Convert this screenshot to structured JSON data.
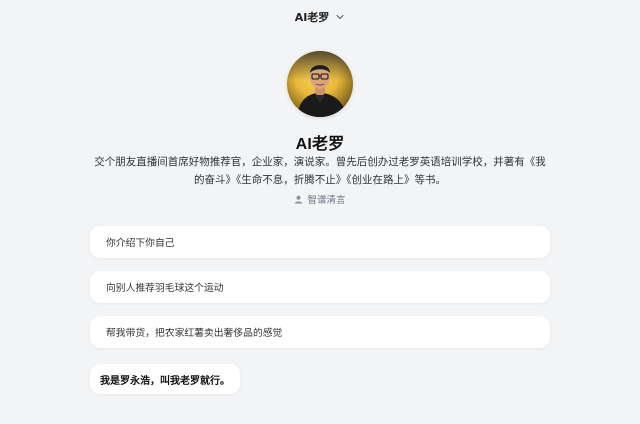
{
  "header": {
    "title": "AI老罗",
    "dropdown_icon": "chevron-down-icon"
  },
  "profile": {
    "avatar_icon": "avatar",
    "name": "AI老罗",
    "description": "交个朋友直播间首席好物推荐官，企业家，演说家。曾先后创办过老罗英语培训学校，并著有《我的奋斗》《生命不息，折腾不止》《创业在路上》等书。",
    "credit_icon": "person-icon",
    "credit": "智谱清言"
  },
  "suggestions": [
    {
      "label": "你介绍下你自己"
    },
    {
      "label": "向别人推荐羽毛球这个运动"
    },
    {
      "label": "帮我带货，把农家红薯卖出奢侈品的感觉"
    }
  ],
  "chat": {
    "first_message": "我是罗永浩，叫我老罗就行。"
  },
  "colors": {
    "background": "#f3f4f6",
    "card": "#ffffff",
    "accent_gold": "#e8b83c"
  }
}
